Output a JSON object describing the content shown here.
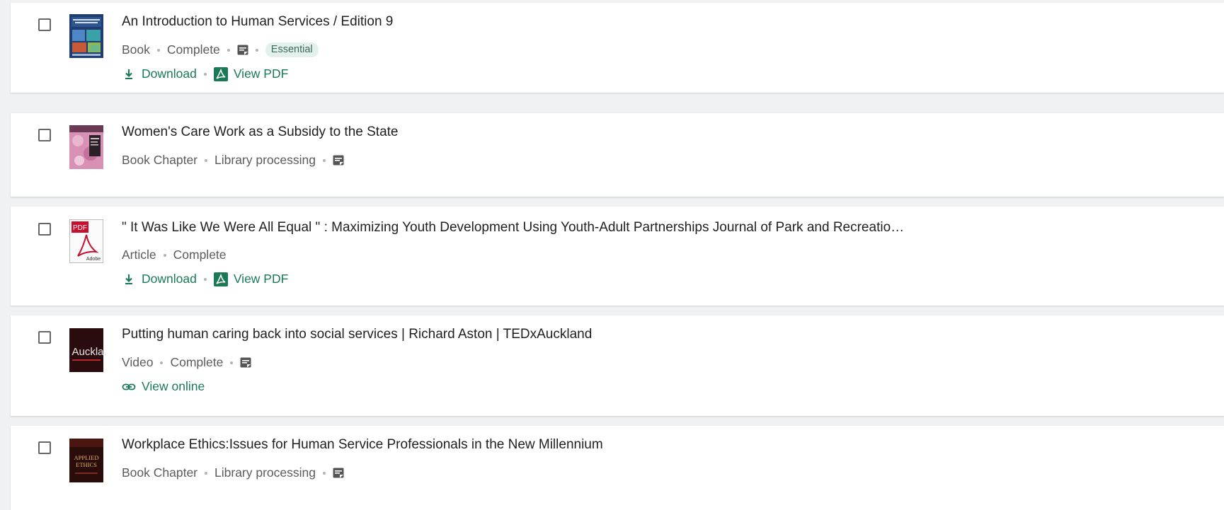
{
  "items": [
    {
      "title": "An Introduction to Human Services / Edition 9",
      "type": "Book",
      "status": "Complete",
      "has_note": true,
      "tag": "Essential",
      "actions": [
        "Download",
        "View PDF"
      ],
      "thumb": "book-cover-human-services"
    },
    {
      "title": "Women's Care Work as a Subsidy to the State",
      "type": "Book Chapter",
      "status": "Library processing",
      "has_note": true,
      "thumb": "book-cover-pink"
    },
    {
      "title": "\" It Was Like We Were All Equal \" : Maximizing Youth Development Using Youth-Adult Partnerships Journal of Park and Recreatio…",
      "type": "Article",
      "status": "Complete",
      "has_note": false,
      "actions": [
        "Download",
        "View PDF"
      ],
      "thumb": "pdf-document-icon",
      "thumb_label_top": "PDF",
      "thumb_label_bottom": "Adobe"
    },
    {
      "title": "Putting human caring back into social services | Richard Aston | TEDxAuckland",
      "type": "Video",
      "status": "Complete",
      "has_note": true,
      "actions": [
        "View online"
      ],
      "thumb": "video-thumbnail",
      "thumb_text": "Auckla"
    },
    {
      "title": "Workplace Ethics:Issues for Human Service Professionals in the New Millennium",
      "type": "Book Chapter",
      "status": "Library processing",
      "has_note": true,
      "thumb": "book-cover-applied-ethics",
      "thumb_text_1": "APPLIED",
      "thumb_text_2": "ETHICS"
    }
  ],
  "colors": {
    "link": "#1a7a56",
    "badge_bg": "#e3f1ec",
    "meta_text": "#5b5b5b"
  },
  "icons": {
    "note": "note-icon",
    "download": "download-icon",
    "pdf": "pdf-icon",
    "link": "link-icon"
  }
}
